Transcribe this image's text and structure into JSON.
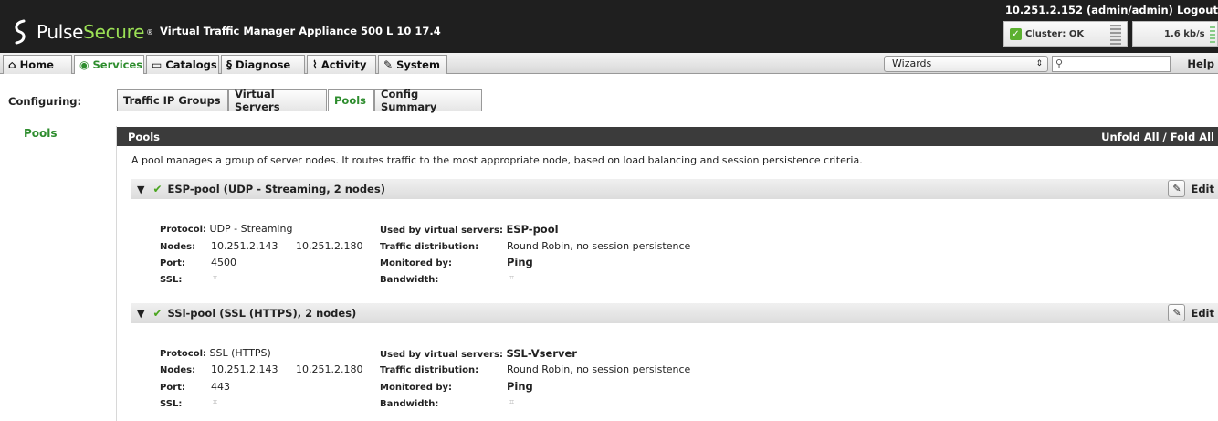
{
  "header": {
    "brand_pulse": "Pulse",
    "brand_secure": "Secure",
    "product": "Virtual Traffic Manager Appliance  500 L 10   17.4",
    "host": "10.251.2.152 (admin/admin) Logout",
    "cluster_status": "Cluster: OK",
    "rate": "1.6 kb/s"
  },
  "nav": {
    "home": "Home",
    "services": "Services",
    "catalogs": "Catalogs",
    "diagnose": "Diagnose",
    "activity": "Activity",
    "system": "System",
    "wizards": "Wizards",
    "search_placeholder": "",
    "help": "Help"
  },
  "configuring": {
    "label": "Configuring:",
    "tabs": [
      "Traffic IP Groups",
      "Virtual Servers",
      "Pools",
      "Config Summary"
    ],
    "active": "Pools"
  },
  "sidebar": {
    "pools": "Pools"
  },
  "section": {
    "title": "Pools",
    "fold": "Unfold All / Fold All",
    "intro": "A pool manages a group of server nodes. It routes traffic to the most appropriate node, based on load balancing and session persistence criteria."
  },
  "labels": {
    "protocol": "Protocol:",
    "nodes": "Nodes:",
    "port": "Port:",
    "ssl": "SSL:",
    "used_by": "Used by virtual servers:",
    "traffic": "Traffic distribution:",
    "monitored": "Monitored by:",
    "bandwidth": "Bandwidth:",
    "edit": "Edit",
    "unset": "⌗"
  },
  "pools": [
    {
      "title": "ESP-pool (UDP - Streaming, 2 nodes)",
      "protocol": "UDP - Streaming",
      "node1": "10.251.2.143",
      "node2": "10.251.2.180",
      "port": "4500",
      "used_by": "ESP-pool",
      "traffic": "Round Robin, no session persistence",
      "monitored": "Ping"
    },
    {
      "title": "SSl-pool (SSL (HTTPS), 2 nodes)",
      "protocol": "SSL (HTTPS)",
      "node1": "10.251.2.143",
      "node2": "10.251.2.180",
      "port": "443",
      "used_by": "SSL-Vserver",
      "traffic": "Round Robin, no session persistence",
      "monitored": "Ping"
    }
  ]
}
